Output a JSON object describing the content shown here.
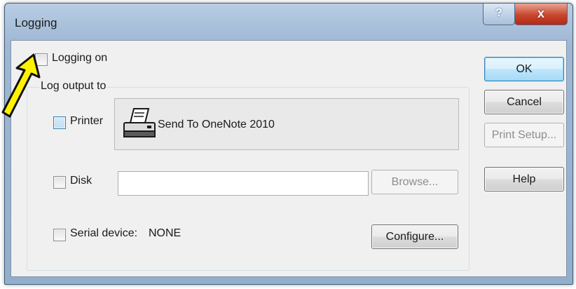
{
  "window": {
    "title": "Logging",
    "help_glyph": "?",
    "close_glyph": "x"
  },
  "logging_on": {
    "label": "Logging on",
    "checked": false
  },
  "log_output": {
    "label": "Log output to",
    "printer": {
      "label": "Printer",
      "checked": false,
      "device_name": "Send To OneNote 2010"
    },
    "disk": {
      "label": "Disk",
      "checked": false,
      "path_value": "",
      "browse_label": "Browse..."
    },
    "serial": {
      "label": "Serial device:",
      "device": "NONE",
      "checked": false,
      "configure_label": "Configure..."
    }
  },
  "buttons": {
    "ok": "OK",
    "cancel": "Cancel",
    "print_setup": "Print Setup...",
    "help": "Help"
  },
  "colors": {
    "arrow_fill": "#fff200",
    "ok_border": "#3c7fb1",
    "close_button": "#c8462f"
  }
}
